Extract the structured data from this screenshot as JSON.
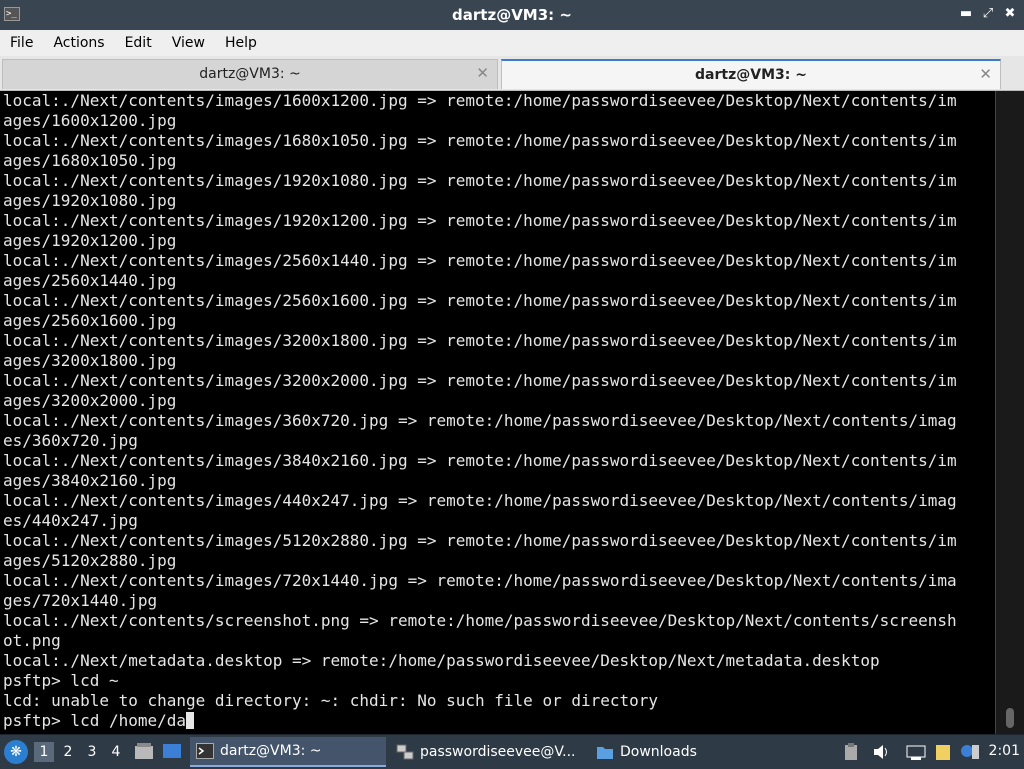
{
  "window": {
    "title": "dartz@VM3: ~"
  },
  "menu": [
    "File",
    "Actions",
    "Edit",
    "View",
    "Help"
  ],
  "tabs": [
    {
      "label": "dartz@VM3: ~",
      "active": false
    },
    {
      "label": "dartz@VM3: ~",
      "active": true
    }
  ],
  "terminal": {
    "lines": [
      "local:./Next/contents/images/1600x1200.jpg => remote:/home/passwordiseevee/Desktop/Next/contents/im",
      "ages/1600x1200.jpg",
      "local:./Next/contents/images/1680x1050.jpg => remote:/home/passwordiseevee/Desktop/Next/contents/im",
      "ages/1680x1050.jpg",
      "local:./Next/contents/images/1920x1080.jpg => remote:/home/passwordiseevee/Desktop/Next/contents/im",
      "ages/1920x1080.jpg",
      "local:./Next/contents/images/1920x1200.jpg => remote:/home/passwordiseevee/Desktop/Next/contents/im",
      "ages/1920x1200.jpg",
      "local:./Next/contents/images/2560x1440.jpg => remote:/home/passwordiseevee/Desktop/Next/contents/im",
      "ages/2560x1440.jpg",
      "local:./Next/contents/images/2560x1600.jpg => remote:/home/passwordiseevee/Desktop/Next/contents/im",
      "ages/2560x1600.jpg",
      "local:./Next/contents/images/3200x1800.jpg => remote:/home/passwordiseevee/Desktop/Next/contents/im",
      "ages/3200x1800.jpg",
      "local:./Next/contents/images/3200x2000.jpg => remote:/home/passwordiseevee/Desktop/Next/contents/im",
      "ages/3200x2000.jpg",
      "local:./Next/contents/images/360x720.jpg => remote:/home/passwordiseevee/Desktop/Next/contents/imag",
      "es/360x720.jpg",
      "local:./Next/contents/images/3840x2160.jpg => remote:/home/passwordiseevee/Desktop/Next/contents/im",
      "ages/3840x2160.jpg",
      "local:./Next/contents/images/440x247.jpg => remote:/home/passwordiseevee/Desktop/Next/contents/imag",
      "es/440x247.jpg",
      "local:./Next/contents/images/5120x2880.jpg => remote:/home/passwordiseevee/Desktop/Next/contents/im",
      "ages/5120x2880.jpg",
      "local:./Next/contents/images/720x1440.jpg => remote:/home/passwordiseevee/Desktop/Next/contents/ima",
      "ges/720x1440.jpg",
      "local:./Next/contents/screenshot.png => remote:/home/passwordiseevee/Desktop/Next/contents/screensh",
      "ot.png",
      "local:./Next/metadata.desktop => remote:/home/passwordiseevee/Desktop/Next/metadata.desktop",
      "psftp> lcd ~",
      "lcd: unable to change directory: ~: chdir: No such file or directory"
    ],
    "prompt_line": "psftp> lcd /home/da"
  },
  "taskbar": {
    "workspaces": [
      "1",
      "2",
      "3",
      "4"
    ],
    "tasks": [
      {
        "label": "dartz@VM3: ~",
        "icon": "terminal-icon",
        "active": true
      },
      {
        "label": "passwordiseevee@V...",
        "icon": "network-icon",
        "active": false
      },
      {
        "label": "Downloads",
        "icon": "folder-icon",
        "active": false
      }
    ],
    "clock": "2:01"
  }
}
